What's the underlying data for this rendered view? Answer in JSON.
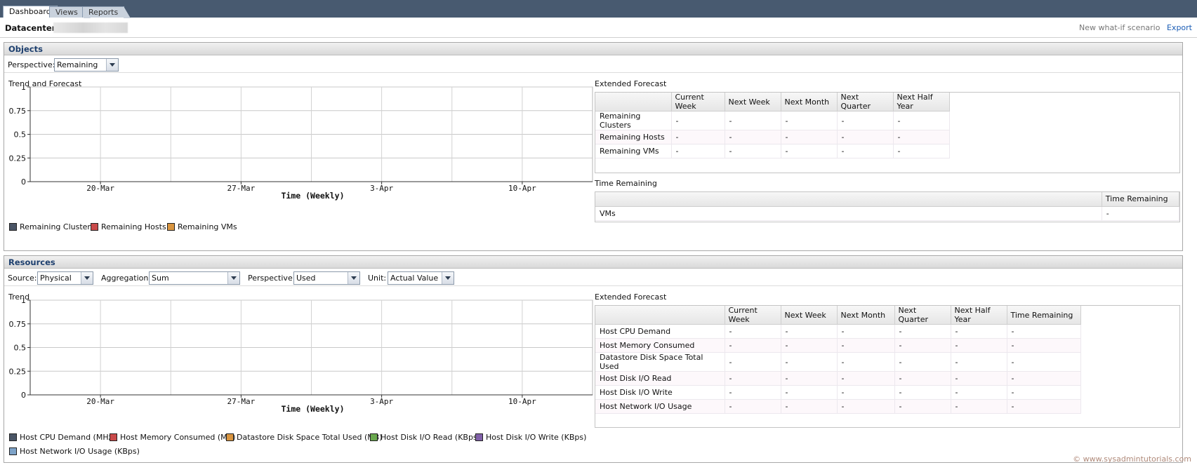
{
  "tabs": [
    "Dashboard",
    "Views",
    "Reports"
  ],
  "header": {
    "datacenter_label": "Datacenter:",
    "what_if": "New what-if scenario",
    "export": "Export"
  },
  "objects": {
    "title": "Objects",
    "perspective_label": "Perspective:",
    "perspective_value": "Remaining",
    "chart_title": "Trend and Forecast",
    "ext_title": "Extended Forecast",
    "ext_columns": [
      "",
      "Current Week",
      "Next Week",
      "Next Month",
      "Next Quarter",
      "Next Half Year"
    ],
    "ext_rows": [
      [
        "Remaining Clusters",
        "-",
        "-",
        "-",
        "-",
        "-"
      ],
      [
        "Remaining Hosts",
        "-",
        "-",
        "-",
        "-",
        "-"
      ],
      [
        "Remaining VMs",
        "-",
        "-",
        "-",
        "-",
        "-"
      ]
    ],
    "time_title": "Time Remaining",
    "time_columns": [
      "",
      "Time Remaining"
    ],
    "time_rows": [
      [
        "VMs",
        "-"
      ]
    ],
    "legend": [
      {
        "label": "Remaining Clusters",
        "color": "#4a5566"
      },
      {
        "label": "Remaining Hosts",
        "color": "#c94a4a"
      },
      {
        "label": "Remaining VMs",
        "color": "#d99540"
      }
    ]
  },
  "resources": {
    "title": "Resources",
    "source_label": "Source:",
    "source_value": "Physical",
    "aggregation_label": "Aggregation:",
    "aggregation_value": "Sum",
    "perspective_label": "Perspective:",
    "perspective_value": "Used",
    "unit_label": "Unit:",
    "unit_value": "Actual Value",
    "chart_title": "Trend",
    "ext_title": "Extended Forecast",
    "ext_columns": [
      "",
      "Current Week",
      "Next Week",
      "Next Month",
      "Next Quarter",
      "Next Half Year",
      "Time Remaining"
    ],
    "ext_rows": [
      [
        "Host CPU Demand",
        "-",
        "-",
        "-",
        "-",
        "-",
        "-"
      ],
      [
        "Host Memory Consumed",
        "-",
        "-",
        "-",
        "-",
        "-",
        "-"
      ],
      [
        "Datastore Disk Space Total Used",
        "-",
        "-",
        "-",
        "-",
        "-",
        "-"
      ],
      [
        "Host Disk I/O Read",
        "-",
        "-",
        "-",
        "-",
        "-",
        "-"
      ],
      [
        "Host Disk I/O Write",
        "-",
        "-",
        "-",
        "-",
        "-",
        "-"
      ],
      [
        "Host Network I/O Usage",
        "-",
        "-",
        "-",
        "-",
        "-",
        "-"
      ]
    ],
    "legend": [
      {
        "label": "Host CPU Demand (MHz)",
        "color": "#4a5566"
      },
      {
        "label": "Host Memory Consumed (MB)",
        "color": "#c94a4a"
      },
      {
        "label": "Datastore Disk Space Total Used (MB)",
        "color": "#d99540"
      },
      {
        "label": "Host Disk I/O Read (KBps)",
        "color": "#6aa84f"
      },
      {
        "label": "Host Disk I/O Write (KBps)",
        "color": "#8060a8"
      },
      {
        "label": "Host Network I/O Usage (KBps)",
        "color": "#7ea3c8"
      }
    ]
  },
  "chart_data": [
    {
      "type": "line",
      "title": "Trend and Forecast",
      "xlabel": "Time (Weekly)",
      "ylabel": "",
      "x_ticks": [
        "20-Mar",
        "27-Mar",
        "3-Apr",
        "10-Apr"
      ],
      "y_ticks": [
        "0",
        "0.25",
        "0.5",
        "0.75",
        "1"
      ],
      "ylim": [
        0,
        1
      ],
      "grid": true,
      "legend_position": "bottom-left",
      "series": [
        {
          "name": "Remaining Clusters",
          "values": []
        },
        {
          "name": "Remaining Hosts",
          "values": []
        },
        {
          "name": "Remaining VMs",
          "values": []
        }
      ]
    },
    {
      "type": "line",
      "title": "Trend",
      "xlabel": "Time (Weekly)",
      "ylabel": "",
      "x_ticks": [
        "20-Mar",
        "27-Mar",
        "3-Apr",
        "10-Apr"
      ],
      "y_ticks": [
        "0",
        "0.25",
        "0.5",
        "0.75",
        "1"
      ],
      "ylim": [
        0,
        1
      ],
      "grid": true,
      "legend_position": "bottom-left",
      "series": [
        {
          "name": "Host CPU Demand (MHz)",
          "values": []
        },
        {
          "name": "Host Memory Consumed (MB)",
          "values": []
        },
        {
          "name": "Datastore Disk Space Total Used (MB)",
          "values": []
        },
        {
          "name": "Host Disk I/O Read (KBps)",
          "values": []
        },
        {
          "name": "Host Disk I/O Write (KBps)",
          "values": []
        },
        {
          "name": "Host Network I/O Usage (KBps)",
          "values": []
        }
      ]
    }
  ],
  "watermark": "© www.sysadmintutorials.com"
}
